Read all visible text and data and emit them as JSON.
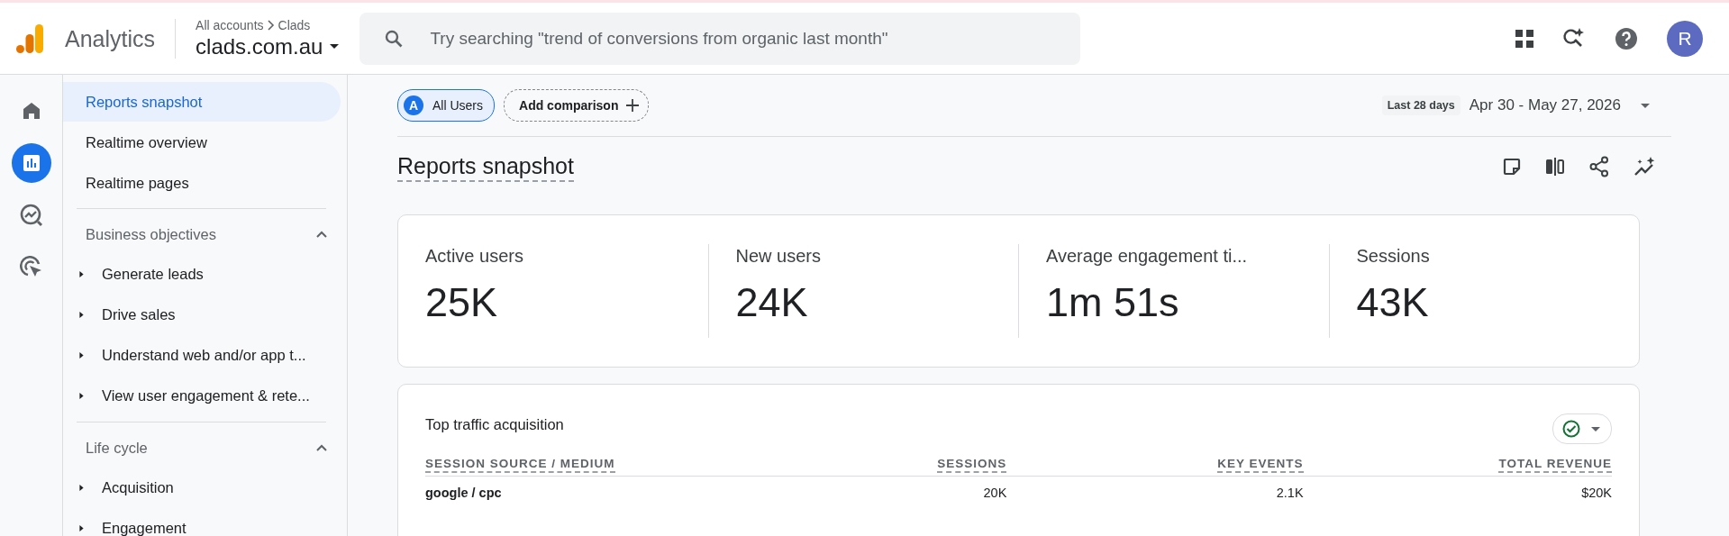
{
  "topbar": {
    "product": "Analytics",
    "breadcrumb": [
      "All accounts",
      "Clads"
    ],
    "property": "clads.com.au",
    "search": {
      "placeholder": "Try searching \"trend of conversions from organic last month\""
    },
    "avatar": "R"
  },
  "rail": [
    {
      "kind": "home",
      "selected": false
    },
    {
      "kind": "reports",
      "selected": true
    },
    {
      "kind": "explore",
      "selected": false
    },
    {
      "kind": "advertising",
      "selected": false
    }
  ],
  "sidebar": {
    "links": [
      {
        "label": "Reports snapshot",
        "selected": true
      },
      {
        "label": "Realtime overview",
        "selected": false
      },
      {
        "label": "Realtime pages",
        "selected": false
      }
    ],
    "sections": [
      {
        "title": "Business objectives",
        "expanded": true,
        "items": [
          {
            "label": "Generate leads",
            "expanded": false
          },
          {
            "label": "Drive sales",
            "expanded": false
          },
          {
            "label": "Understand web and/or app t...",
            "expanded": false
          },
          {
            "label": "View user engagement & rete...",
            "expanded": false
          }
        ]
      },
      {
        "title": "Life cycle",
        "expanded": true,
        "items": [
          {
            "label": "Acquisition",
            "expanded": false
          },
          {
            "label": "Engagement",
            "expanded": false
          }
        ]
      }
    ]
  },
  "toolbar": {
    "segment": {
      "badge": "A",
      "label": "All Users"
    },
    "add_comparison": "Add comparison",
    "date_preset": "Last 28 days",
    "date_range": "Apr 30 - May 27, 2026"
  },
  "title": "Reports snapshot",
  "metrics": [
    {
      "label": "Active users",
      "value": "25K"
    },
    {
      "label": "New users",
      "value": "24K"
    },
    {
      "label": "Average engagement ti...",
      "value": "1m 51s"
    },
    {
      "label": "Sessions",
      "value": "43K"
    }
  ],
  "traffic_table": {
    "title": "Top traffic acquisition",
    "columns": [
      "SESSION SOURCE / MEDIUM",
      "SESSIONS",
      "KEY EVENTS",
      "TOTAL REVENUE"
    ],
    "rows": [
      [
        "google / cpc",
        "20K",
        "2.1K",
        "$20K"
      ]
    ]
  }
}
